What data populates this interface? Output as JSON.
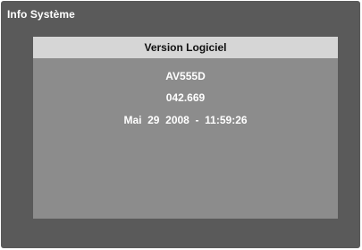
{
  "window": {
    "title": "Info Système"
  },
  "panel": {
    "header": "Version Logiciel",
    "model": "AV555D",
    "version": "042.669",
    "build_date": "Mai  29  2008  -  11:59:26"
  },
  "colors": {
    "frame_background": "#5a5a5a",
    "panel_background": "#8c8c8c",
    "panel_header_background": "#d6d6d6",
    "text_primary": "#ffffff",
    "header_text": "#111111"
  }
}
